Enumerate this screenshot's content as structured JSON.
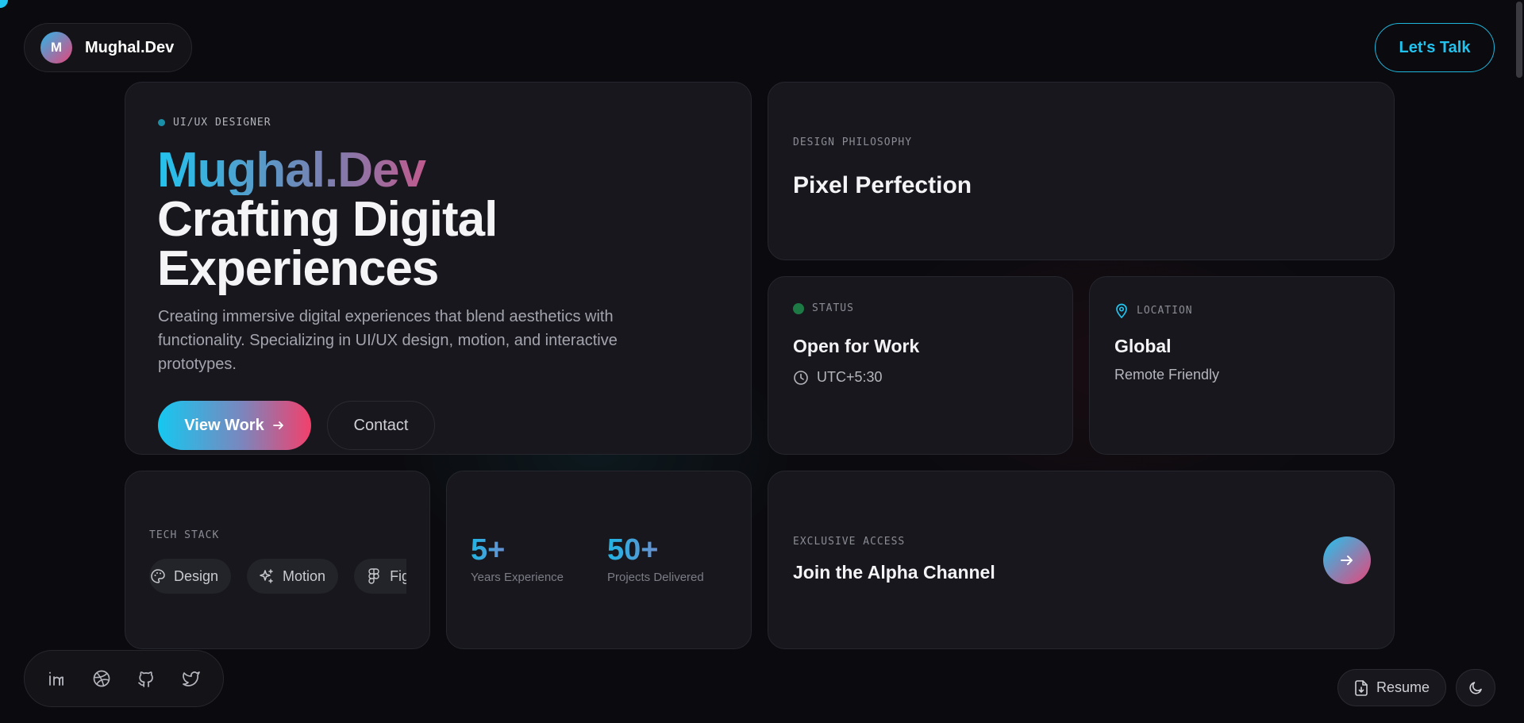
{
  "brand": {
    "logo_letter": "M",
    "name": "Mughal.Dev"
  },
  "header": {
    "cta_label": "Let's Talk"
  },
  "hero": {
    "tag": "UI/UX DESIGNER",
    "title_gradient": "Mughal.Dev",
    "title_line1": "Crafting Digital",
    "title_line2": "Experiences",
    "description": "Creating immersive digital experiences that blend aesthetics with functionality. Specializing in UI/UX design, motion, and interactive prototypes.",
    "primary_button": "View Work",
    "secondary_button": "Contact"
  },
  "philosophy": {
    "label": "DESIGN PHILOSOPHY",
    "title": "Pixel Perfection"
  },
  "status": {
    "label": "STATUS",
    "title": "Open for Work",
    "timezone": "UTC+5:30"
  },
  "location": {
    "label": "LOCATION",
    "title": "Global",
    "subtitle": "Remote Friendly"
  },
  "tech_stack": {
    "label": "TECH STACK",
    "chips": [
      {
        "label": "Design",
        "icon": "palette-icon"
      },
      {
        "label": "Motion",
        "icon": "sparkles-icon"
      },
      {
        "label": "Figma",
        "icon": "figma-icon"
      }
    ]
  },
  "stats": [
    {
      "value": "5+",
      "label": "Years Experience"
    },
    {
      "value": "50+",
      "label": "Projects Delivered"
    }
  ],
  "alpha": {
    "label": "EXCLUSIVE ACCESS",
    "title": "Join the Alpha Channel"
  },
  "socials": [
    "linkedin-icon",
    "dribbble-icon",
    "github-icon",
    "twitter-icon"
  ],
  "footer": {
    "resume_label": "Resume"
  },
  "colors": {
    "accent_cyan": "#22c3ee",
    "accent_pink": "#f04074",
    "background": "#0b0b0f",
    "card": "#17171d"
  }
}
